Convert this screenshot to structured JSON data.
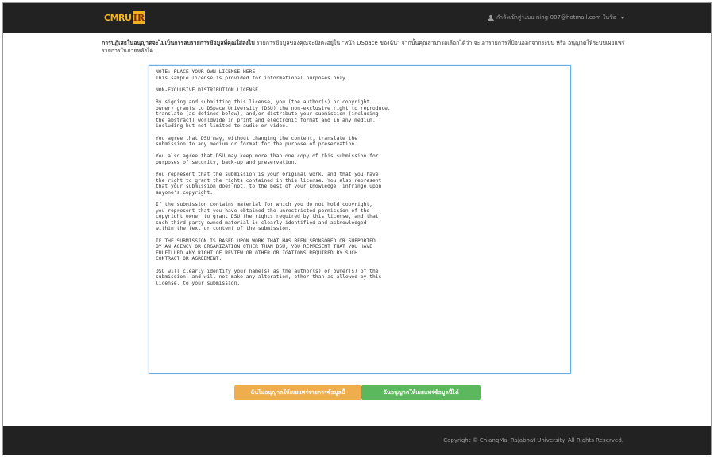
{
  "navbar": {
    "logo_text": "CMRU",
    "logo_badge": "IR",
    "user_label": "กำลังเข้าสู่ระบบ ning-007@hotmail.com ในชื่อ"
  },
  "intro": {
    "bold": "การปฏิเสธในอนุญาตจะไม่เป็นการลบรายการข้อมูลที่คุณใส่ลงไป",
    "text": " รายการข้อมูลของคุณจะยังคงอยู่ใน \"หน้า DSpace ของฉัน\" จากนั้นคุณสามารถเลือกได้ว่า จะเอารายการที่ป้อนออกจากระบบ หรือ อนุญาตให้ระบบเผยแพร่รายการในภายหลังได้"
  },
  "license": {
    "text": "NOTE: PLACE YOUR OWN LICENSE HERE\nThis sample license is provided for informational purposes only.\n\nNON-EXCLUSIVE DISTRIBUTION LICENSE\n\nBy signing and submitting this license, you (the author(s) or copyright\nowner) grants to DSpace University (DSU) the non-exclusive right to reproduce,\ntranslate (as defined below), and/or distribute your submission (including\nthe abstract) worldwide in print and electronic format and in any medium,\nincluding but not limited to audio or video.\n\nYou agree that DSU may, without changing the content, translate the\nsubmission to any medium or format for the purpose of preservation.\n\nYou also agree that DSU may keep more than one copy of this submission for\npurposes of security, back-up and preservation.\n\nYou represent that the submission is your original work, and that you have\nthe right to grant the rights contained in this license. You also represent\nthat your submission does not, to the best of your knowledge, infringe upon\nanyone's copyright.\n\nIf the submission contains material for which you do not hold copyright,\nyou represent that you have obtained the unrestricted permission of the\ncopyright owner to grant DSU the rights required by this license, and that\nsuch third-party owned material is clearly identified and acknowledged\nwithin the text or content of the submission.\n\nIF THE SUBMISSION IS BASED UPON WORK THAT HAS BEEN SPONSORED OR SUPPORTED\nBY AN AGENCY OR ORGANIZATION OTHER THAN DSU, YOU REPRESENT THAT YOU HAVE\nFULFILLED ANY RIGHT OF REVIEW OR OTHER OBLIGATIONS REQUIRED BY SUCH\nCONTRACT OR AGREEMENT.\n\nDSU will clearly identify your name(s) as the author(s) or owner(s) of the\nsubmission, and will not make any alteration, other than as allowed by this\nlicense, to your submission."
  },
  "buttons": {
    "reject": "ฉันไม่อนุญาตให้เผยแพร่รายการข้อมูลนี้",
    "accept": "ฉันอนุญาตให้เผยแพร่ข้อมูลนี้ได้"
  },
  "footer": {
    "copyright": "Copyright © ChiangMai Rajabhat University. All Rights Reserved."
  },
  "colors": {
    "navbar": "#222222",
    "reject_button": "#f0ad4e",
    "accept_button": "#5cb85c",
    "logo": "#f0b51e"
  },
  "icons": [
    "user-icon",
    "caret-down-icon"
  ]
}
